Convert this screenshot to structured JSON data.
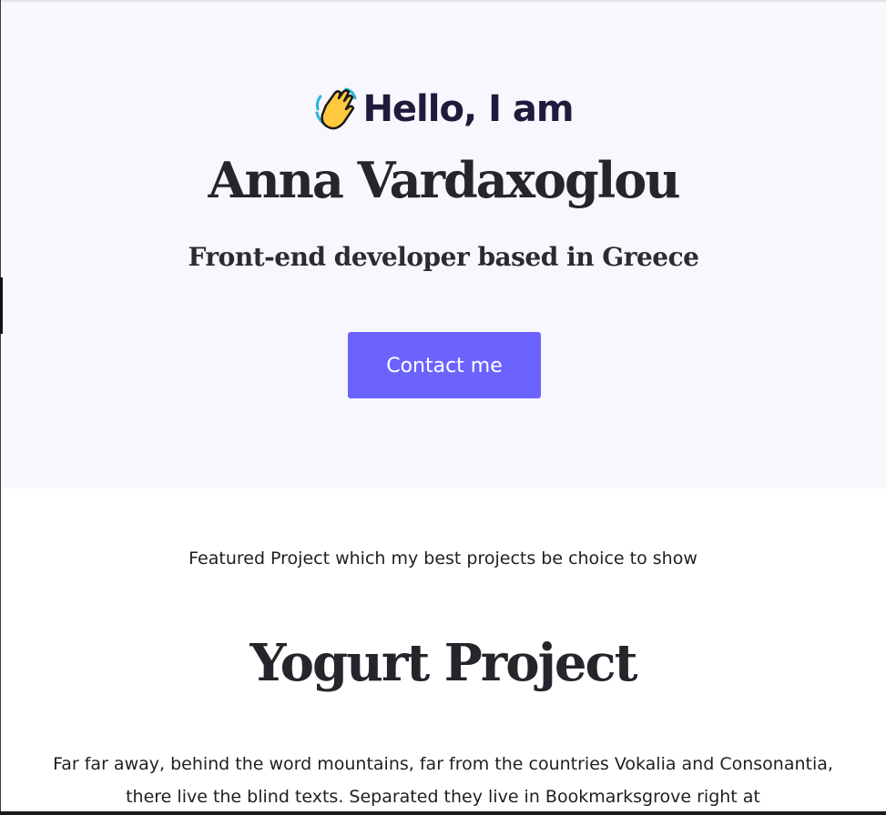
{
  "hero": {
    "wave_icon": "waving-hand-icon",
    "greeting": "Hello, I am",
    "name": "Anna Vardaxoglou",
    "subtitle": "Front-end developer based in Greece",
    "contact_button_label": "Contact me",
    "background_color": "#f8f7fd",
    "accent_color": "#6c63ff"
  },
  "featured": {
    "tagline": "Featured Project which my best projects be choice to show",
    "project_title": "Yogurt Project",
    "project_description": "Far far away, behind the word mountains, far from the countries Vokalia and Consonantia, there live the blind texts. Separated they live in Bookmarksgrove right at"
  }
}
